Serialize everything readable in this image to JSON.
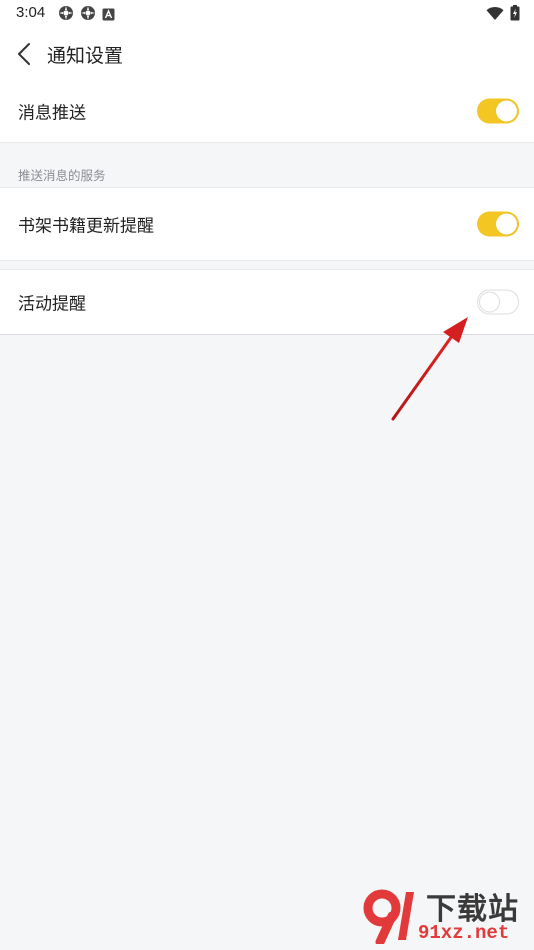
{
  "status_bar": {
    "time": "3:04",
    "left_icons": [
      "settings-gear-icon",
      "settings-gear-icon",
      "notification-a-icon"
    ],
    "right_icons": [
      "wifi-icon",
      "battery-charging-icon"
    ]
  },
  "header": {
    "back_icon": "chevron-left-icon",
    "title": "通知设置"
  },
  "settings": {
    "message_push": {
      "label": "消息推送",
      "enabled": true
    },
    "section_title": "推送消息的服务",
    "bookshelf_update": {
      "label": "书架书籍更新提醒",
      "enabled": true
    },
    "activity_reminder": {
      "label": "活动提醒",
      "enabled": false
    }
  },
  "annotation": {
    "arrow_color": "#d42020",
    "points_to": "activity-reminder-toggle"
  },
  "watermark": {
    "title": "下载站",
    "url": "91xz.net"
  },
  "colors": {
    "toggle_on": "#f3c623",
    "page_background": "#f5f6f8",
    "card_background": "#ffffff"
  }
}
